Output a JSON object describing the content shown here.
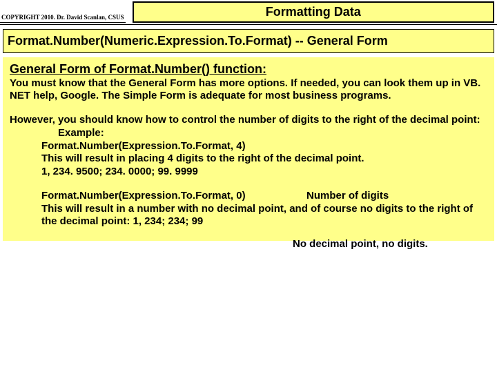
{
  "header": {
    "copyright": "COPYRIGHT 2010. Dr. David Scanlan, CSUS",
    "title": "Formatting Data"
  },
  "subtitle": "Format.Number(Numeric.Expression.To.Format)  -- General Form",
  "content": {
    "heading": "General Form of Format.Number() function:",
    "p1": "You must know that the General Form has more options.  If needed, you can look them up in VB. NET help, Google.  The Simple Form is adequate for most business programs.",
    "p2": "However, you should know how to control the number of digits to the right of the decimal point:",
    "example_label": "Example:",
    "example_code1": "Format.Number(Expression.To.Format, 4)",
    "annot1": "Number of digits",
    "p3": "This will result in placing 4 digits to the right of the decimal point.",
    "p4": "1, 234. 9500;  234. 0000;  99. 9999",
    "annot2": "No decimal point, no digits.",
    "example_code2": "Format.Number(Expression.To.Format, 0)",
    "p5": "This will result in a number with no decimal point, and of course no digits to    the right of the decimal point: 1, 234;  234;  99"
  }
}
